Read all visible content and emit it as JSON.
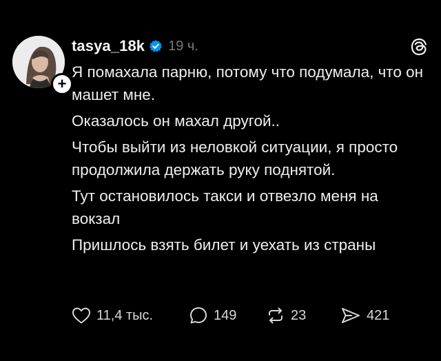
{
  "post": {
    "author": {
      "username": "tasya_18k",
      "verified": true,
      "time_ago": "19 ч."
    },
    "text_paragraphs": [
      "Я помахала парню, потому что подумала, что он машет мне.",
      "Оказалось он махал другой..",
      "Чтобы выйти из неловкой ситуации, я просто продолжила держать руку поднятой.",
      "Тут остановилось такси и отвезло меня на вокзал",
      "Пришлось взять билет и уехать из страны"
    ],
    "stats": {
      "likes": "11,4 тыс.",
      "replies": "149",
      "reposts": "23",
      "shares": "421"
    }
  },
  "icons": {
    "app_logo": "threads-logo-icon",
    "follow": "plus-icon",
    "verified": "verified-badge-icon",
    "like": "heart-icon",
    "reply": "comment-bubble-icon",
    "repost": "repost-arrows-icon",
    "share": "send-arrow-icon"
  },
  "colors": {
    "background": "#000000",
    "text": "#efefef",
    "muted": "#7a7a7a",
    "verified": "#0095f6"
  }
}
